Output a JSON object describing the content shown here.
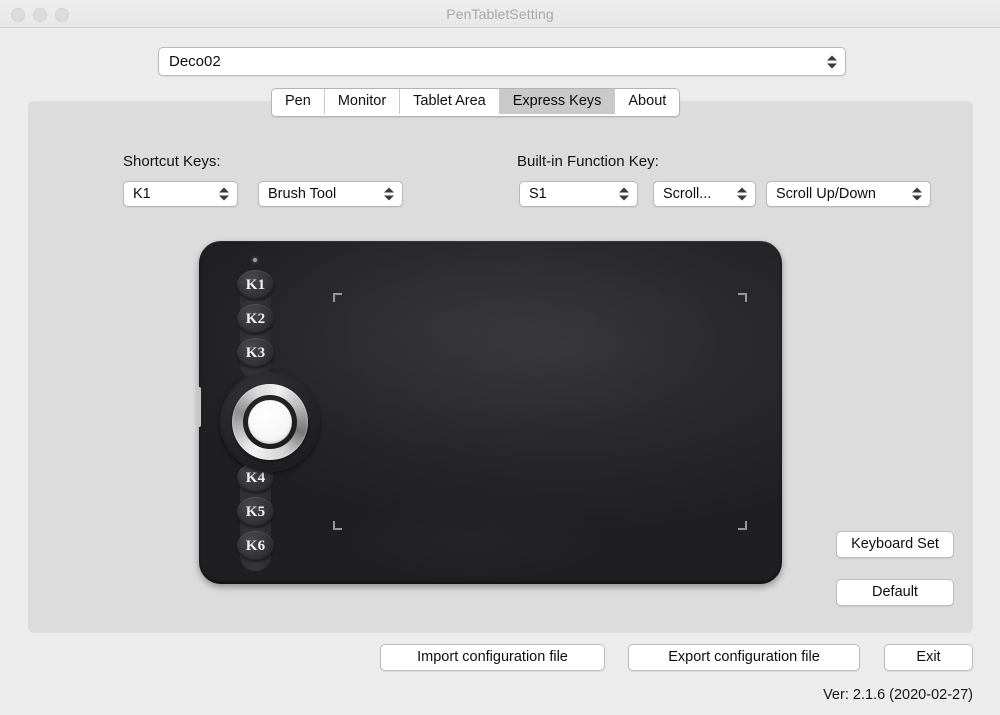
{
  "window": {
    "title": "PenTabletSetting",
    "traffic_lights": [
      "close",
      "minimize",
      "zoom"
    ]
  },
  "device_selector": {
    "value": "Deco02",
    "icon": "stepper-chevrons-icon"
  },
  "tabs": [
    {
      "label": "Pen",
      "selected": false
    },
    {
      "label": "Monitor",
      "selected": false
    },
    {
      "label": "Tablet Area",
      "selected": false
    },
    {
      "label": "Express Keys",
      "selected": true
    },
    {
      "label": "About",
      "selected": false
    }
  ],
  "shortcut_keys": {
    "label": "Shortcut Keys:",
    "key_select": "K1",
    "function_select": "Brush Tool"
  },
  "builtin_function_key": {
    "label": "Built-in Function Key:",
    "key_select": "S1",
    "mode_select": "Scroll...",
    "direction_select": "Scroll Up/Down"
  },
  "tablet": {
    "express_keys": [
      "K1",
      "K2",
      "K3",
      "K4",
      "K5",
      "K6"
    ],
    "ring_dial": "ring-dial",
    "led": "led-indicator",
    "crop_marks": 4
  },
  "buttons": {
    "keyboard_set": "Keyboard Set",
    "default": "Default",
    "import": "Import configuration file",
    "export": "Export configuration file",
    "exit": "Exit"
  },
  "version": "Ver: 2.1.6 (2020-02-27)",
  "colors": {
    "window_bg": "#ececec",
    "panel_bg": "#dcdcdc",
    "titlebar_bg": "#eeeeee",
    "tab_selected_bg": "#c9c9c9",
    "control_bg": "#ffffff",
    "tablet_body": "#2a2a2c",
    "text": "#111111",
    "title_text": "#a8a8a8"
  }
}
